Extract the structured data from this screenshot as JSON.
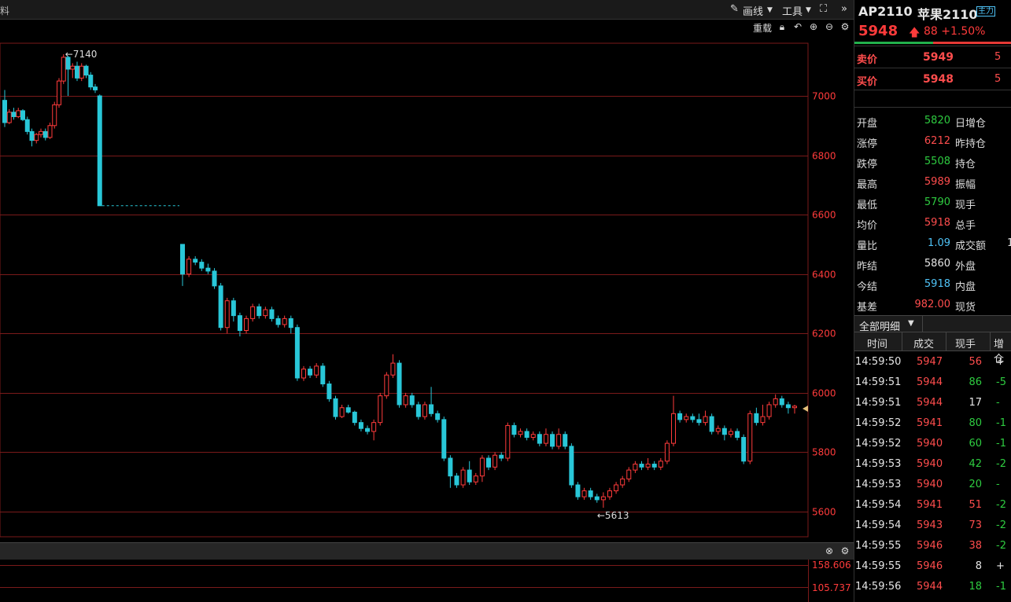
{
  "toolbar": {
    "left_tab": "料",
    "draw_label": "画线",
    "tools_label": "工具",
    "reload_label": "重载"
  },
  "quote": {
    "code": "AP2110",
    "name": "苹果2110",
    "badge": "主力",
    "price": "5948",
    "change": "88",
    "change_pct": "+1.50%",
    "bar_green_ratio": 0.5
  },
  "orderbook": [
    {
      "label": "卖价",
      "price": "5949",
      "volume": "5"
    },
    {
      "label": "买价",
      "price": "5948",
      "volume": "5"
    }
  ],
  "stats": [
    {
      "k": "开盘",
      "v": "5820",
      "c": "green",
      "k2": "日增仓",
      "v2": ""
    },
    {
      "k": "涨停",
      "v": "6212",
      "c": "red",
      "k2": "昨持仓",
      "v2": ""
    },
    {
      "k": "跌停",
      "v": "5508",
      "c": "green",
      "k2": "持仓",
      "v2": ""
    },
    {
      "k": "最高",
      "v": "5989",
      "c": "red",
      "k2": "振幅",
      "v2": ""
    },
    {
      "k": "最低",
      "v": "5790",
      "c": "green",
      "k2": "现手",
      "v2": ""
    },
    {
      "k": "均价",
      "v": "5918",
      "c": "red",
      "k2": "总手",
      "v2": ""
    },
    {
      "k": "量比",
      "v": "1.09",
      "c": "cyan",
      "k2": "成交额",
      "v2": "1"
    },
    {
      "k": "昨结",
      "v": "5860",
      "c": "white",
      "k2": "外盘",
      "v2": ""
    },
    {
      "k": "今结",
      "v": "5918",
      "c": "cyan",
      "k2": "内盘",
      "v2": ""
    },
    {
      "k": "基差",
      "v": "982.00",
      "c": "red",
      "k2": "现货",
      "v2": ""
    }
  ],
  "detail": {
    "tab_label": "全部明细",
    "columns": [
      "时间",
      "成交",
      "现手",
      "增仓"
    ]
  },
  "ticks": [
    {
      "time": "14:59:50",
      "price": "5947",
      "qty": "56",
      "qc": "red",
      "oi": "+"
    },
    {
      "time": "14:59:51",
      "price": "5944",
      "qty": "86",
      "qc": "green",
      "oi": "-5"
    },
    {
      "time": "14:59:51",
      "price": "5944",
      "qty": "17",
      "qc": "white",
      "oi": "-"
    },
    {
      "time": "14:59:52",
      "price": "5941",
      "qty": "80",
      "qc": "green",
      "oi": "-1"
    },
    {
      "time": "14:59:52",
      "price": "5940",
      "qty": "60",
      "qc": "green",
      "oi": "-1"
    },
    {
      "time": "14:59:53",
      "price": "5940",
      "qty": "42",
      "qc": "green",
      "oi": "-2"
    },
    {
      "time": "14:59:53",
      "price": "5940",
      "qty": "20",
      "qc": "green",
      "oi": "-"
    },
    {
      "time": "14:59:54",
      "price": "5941",
      "qty": "51",
      "qc": "red",
      "oi": "-2"
    },
    {
      "time": "14:59:54",
      "price": "5943",
      "qty": "73",
      "qc": "red",
      "oi": "-2"
    },
    {
      "time": "14:59:55",
      "price": "5946",
      "qty": "38",
      "qc": "red",
      "oi": "-2"
    },
    {
      "time": "14:59:55",
      "price": "5946",
      "qty": "8",
      "qc": "white",
      "oi": "+"
    },
    {
      "time": "14:59:56",
      "price": "5944",
      "qty": "18",
      "qc": "green",
      "oi": "-1"
    }
  ],
  "chart_data": {
    "type": "candlestick",
    "y_ticks": [
      7000,
      6800,
      6600,
      6400,
      6200,
      6000,
      5800,
      5600
    ],
    "high_label": "7140",
    "low_label": "5613",
    "lower_ticks": [
      "158.606",
      "105.737"
    ],
    "colors": {
      "up": "#ff3b3b",
      "down": "#29c7d8",
      "grid": "#7a1a1a",
      "axis": "#ff3b3b"
    },
    "candles": [
      [
        6985,
        6910,
        7020,
        6895
      ],
      [
        6910,
        6945,
        6955,
        6905
      ],
      [
        6945,
        6930,
        6960,
        6920
      ],
      [
        6930,
        6950,
        6960,
        6925
      ],
      [
        6950,
        6920,
        6955,
        6915
      ],
      [
        6920,
        6880,
        6930,
        6870
      ],
      [
        6880,
        6850,
        6890,
        6830
      ],
      [
        6850,
        6870,
        6875,
        6840
      ],
      [
        6870,
        6880,
        6890,
        6860
      ],
      [
        6880,
        6860,
        6890,
        6850
      ],
      [
        6860,
        6900,
        6910,
        6855
      ],
      [
        6900,
        6970,
        6980,
        6890
      ],
      [
        6970,
        7050,
        7060,
        6960
      ],
      [
        7050,
        7130,
        7140,
        7040
      ],
      [
        7130,
        7090,
        7135,
        7000
      ],
      [
        7090,
        7100,
        7110,
        7060
      ],
      [
        7100,
        7060,
        7115,
        7050
      ],
      [
        7060,
        7100,
        7110,
        7050
      ],
      [
        7100,
        7070,
        7105,
        7060
      ],
      [
        7070,
        7030,
        7080,
        7020
      ],
      [
        7030,
        7020,
        7040,
        7010
      ],
      [
        7000,
        6630,
        7005,
        6630
      ],
      [
        6500,
        6400,
        6500,
        6360
      ],
      [
        6400,
        6450,
        6460,
        6390
      ],
      [
        6450,
        6440,
        6460,
        6430
      ],
      [
        6440,
        6420,
        6450,
        6410
      ],
      [
        6420,
        6410,
        6435,
        6400
      ],
      [
        6410,
        6360,
        6420,
        6350
      ],
      [
        6360,
        6220,
        6370,
        6210
      ],
      [
        6220,
        6310,
        6320,
        6200
      ],
      [
        6310,
        6260,
        6320,
        6240
      ],
      [
        6260,
        6210,
        6270,
        6190
      ],
      [
        6210,
        6250,
        6260,
        6200
      ],
      [
        6250,
        6290,
        6300,
        6240
      ],
      [
        6290,
        6260,
        6300,
        6250
      ],
      [
        6260,
        6280,
        6290,
        6250
      ],
      [
        6280,
        6250,
        6290,
        6240
      ],
      [
        6250,
        6230,
        6260,
        6220
      ],
      [
        6230,
        6250,
        6260,
        6220
      ],
      [
        6250,
        6220,
        6260,
        6200
      ],
      [
        6220,
        6050,
        6230,
        6040
      ],
      [
        6050,
        6080,
        6090,
        6040
      ],
      [
        6080,
        6060,
        6090,
        6050
      ],
      [
        6060,
        6090,
        6100,
        6050
      ],
      [
        6090,
        6030,
        6100,
        6020
      ],
      [
        6030,
        5980,
        6040,
        5970
      ],
      [
        5980,
        5920,
        5990,
        5910
      ],
      [
        5920,
        5950,
        5960,
        5915
      ],
      [
        5950,
        5935,
        5960,
        5930
      ],
      [
        5935,
        5900,
        5940,
        5890
      ],
      [
        5900,
        5880,
        5910,
        5870
      ],
      [
        5880,
        5870,
        5890,
        5860
      ],
      [
        5870,
        5900,
        5910,
        5840
      ],
      [
        5900,
        5990,
        6000,
        5890
      ],
      [
        5990,
        6060,
        6070,
        5980
      ],
      [
        6060,
        6100,
        6130,
        6050
      ],
      [
        6100,
        5960,
        6110,
        5950
      ],
      [
        5960,
        5990,
        6000,
        5950
      ],
      [
        5990,
        5960,
        6000,
        5950
      ],
      [
        5960,
        5920,
        5970,
        5910
      ],
      [
        5920,
        5960,
        5970,
        5910
      ],
      [
        5960,
        5930,
        6020,
        5920
      ],
      [
        5930,
        5910,
        5940,
        5900
      ],
      [
        5910,
        5780,
        5920,
        5770
      ],
      [
        5780,
        5720,
        5790,
        5680
      ],
      [
        5720,
        5690,
        5730,
        5680
      ],
      [
        5690,
        5740,
        5750,
        5680
      ],
      [
        5740,
        5700,
        5770,
        5690
      ],
      [
        5700,
        5720,
        5730,
        5690
      ],
      [
        5720,
        5780,
        5790,
        5700
      ],
      [
        5780,
        5750,
        5790,
        5740
      ],
      [
        5750,
        5790,
        5800,
        5740
      ],
      [
        5790,
        5780,
        5800,
        5770
      ],
      [
        5780,
        5890,
        5900,
        5770
      ],
      [
        5890,
        5860,
        5900,
        5850
      ],
      [
        5860,
        5870,
        5880,
        5850
      ],
      [
        5870,
        5850,
        5880,
        5840
      ],
      [
        5850,
        5860,
        5870,
        5840
      ],
      [
        5860,
        5830,
        5870,
        5820
      ],
      [
        5830,
        5860,
        5880,
        5820
      ],
      [
        5860,
        5820,
        5870,
        5810
      ],
      [
        5820,
        5860,
        5880,
        5810
      ],
      [
        5860,
        5820,
        5870,
        5810
      ],
      [
        5820,
        5690,
        5830,
        5680
      ],
      [
        5690,
        5650,
        5700,
        5640
      ],
      [
        5650,
        5670,
        5680,
        5640
      ],
      [
        5670,
        5650,
        5680,
        5640
      ],
      [
        5650,
        5640,
        5660,
        5630
      ],
      [
        5640,
        5650,
        5665,
        5613
      ],
      [
        5650,
        5670,
        5680,
        5640
      ],
      [
        5670,
        5690,
        5700,
        5660
      ],
      [
        5690,
        5710,
        5720,
        5680
      ],
      [
        5710,
        5740,
        5750,
        5700
      ],
      [
        5740,
        5760,
        5770,
        5730
      ],
      [
        5760,
        5750,
        5770,
        5740
      ],
      [
        5750,
        5760,
        5780,
        5740
      ],
      [
        5760,
        5750,
        5770,
        5740
      ],
      [
        5750,
        5770,
        5780,
        5740
      ],
      [
        5770,
        5830,
        5840,
        5760
      ],
      [
        5830,
        5930,
        5990,
        5820
      ],
      [
        5930,
        5910,
        5940,
        5900
      ],
      [
        5910,
        5920,
        5930,
        5900
      ],
      [
        5920,
        5910,
        5930,
        5900
      ],
      [
        5910,
        5900,
        5930,
        5890
      ],
      [
        5900,
        5920,
        5940,
        5890
      ],
      [
        5920,
        5870,
        5930,
        5860
      ],
      [
        5870,
        5880,
        5890,
        5860
      ],
      [
        5880,
        5860,
        5890,
        5840
      ],
      [
        5860,
        5870,
        5880,
        5850
      ],
      [
        5870,
        5850,
        5880,
        5840
      ],
      [
        5850,
        5770,
        5860,
        5760
      ],
      [
        5770,
        5930,
        5940,
        5760
      ],
      [
        5930,
        5900,
        5950,
        5890
      ],
      [
        5900,
        5920,
        5960,
        5890
      ],
      [
        5920,
        5960,
        5970,
        5910
      ],
      [
        5960,
        5980,
        5995,
        5950
      ],
      [
        5980,
        5960,
        5990,
        5950
      ],
      [
        5960,
        5950,
        5970,
        5930
      ],
      [
        5950,
        5955,
        5960,
        5930
      ]
    ]
  }
}
